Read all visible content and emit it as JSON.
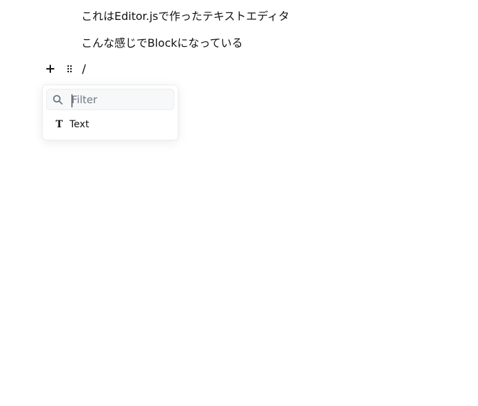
{
  "editor": {
    "blocks": [
      {
        "text": "これはEditor.jsで作ったテキストエディタ"
      },
      {
        "text": "こんな感じでBlockになっている"
      }
    ],
    "toolbar": {
      "plus_icon": "plus-icon",
      "drag_icon": "drag-handle-icon"
    },
    "current_input": {
      "value": "/"
    },
    "popover": {
      "search": {
        "placeholder": "Filter",
        "icon": "search-icon"
      },
      "items": [
        {
          "icon": "T",
          "label": "Text"
        }
      ]
    }
  }
}
